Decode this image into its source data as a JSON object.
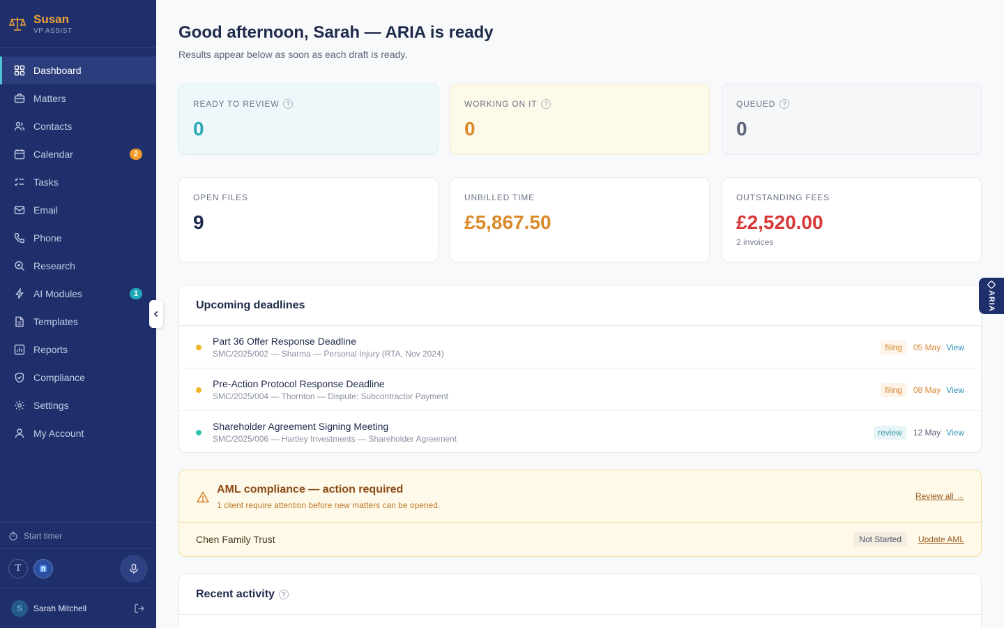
{
  "brand": {
    "name": "Susan",
    "subtitle": "VP ASSIST"
  },
  "sidebar": {
    "items": [
      {
        "label": "Dashboard",
        "icon": "grid-icon",
        "active": true
      },
      {
        "label": "Matters",
        "icon": "briefcase-icon"
      },
      {
        "label": "Contacts",
        "icon": "users-icon"
      },
      {
        "label": "Calendar",
        "icon": "calendar-icon",
        "badge": "2"
      },
      {
        "label": "Tasks",
        "icon": "checklist-icon"
      },
      {
        "label": "Email",
        "icon": "mail-icon"
      },
      {
        "label": "Phone",
        "icon": "phone-icon"
      },
      {
        "label": "Research",
        "icon": "search-icon"
      },
      {
        "label": "AI Modules",
        "icon": "bolt-icon",
        "badge": "1"
      },
      {
        "label": "Templates",
        "icon": "document-icon"
      },
      {
        "label": "Reports",
        "icon": "chart-icon"
      },
      {
        "label": "Compliance",
        "icon": "shield-icon"
      },
      {
        "label": "Settings",
        "icon": "gear-icon"
      },
      {
        "label": "My Account",
        "icon": "user-icon"
      }
    ],
    "timer_label": "Start timer",
    "tools": {
      "t_label": "T"
    },
    "user": {
      "initial": "S",
      "name": "Sarah Mitchell"
    }
  },
  "header": {
    "greeting": "Good afternoon, Sarah — ARIA is ready",
    "subtitle": "Results appear below as soon as each draft is ready."
  },
  "status_cards": {
    "ready": {
      "label": "READY TO REVIEW",
      "value": "0"
    },
    "working": {
      "label": "WORKING ON IT",
      "value": "0"
    },
    "queued": {
      "label": "QUEUED",
      "value": "0"
    }
  },
  "metric_cards": {
    "open_files": {
      "label": "OPEN FILES",
      "value": "9"
    },
    "unbilled": {
      "label": "UNBILLED TIME",
      "value": "£5,867.50"
    },
    "fees": {
      "label": "OUTSTANDING FEES",
      "value": "£2,520.00",
      "sub": "2 invoices"
    }
  },
  "deadlines": {
    "title": "Upcoming deadlines",
    "rows": [
      {
        "title": "Part 36 Offer Response Deadline",
        "meta": "SMC/2025/002 — Sharma — Personal Injury (RTA, Nov 2024)",
        "tag": "filing",
        "date": "05 May",
        "link": "View"
      },
      {
        "title": "Pre-Action Protocol Response Deadline",
        "meta": "SMC/2025/004 — Thornton — Dispute: Subcontractor Payment",
        "tag": "filing",
        "date": "08 May",
        "link": "View"
      },
      {
        "title": "Shareholder Agreement Signing Meeting",
        "meta": "SMC/2025/006 — Hartley Investments — Shareholder Agreement",
        "tag": "review",
        "date": "12 May",
        "link": "View"
      }
    ]
  },
  "aml": {
    "title": "AML compliance — action required",
    "subtitle": "1 client require attention before new matters can be opened.",
    "review_link": "Review all →",
    "client": "Chen Family Trust",
    "status": "Not Started",
    "update_link": "Update AML"
  },
  "recent": {
    "title": "Recent activity"
  },
  "aria_tab": {
    "label": "ARIA"
  },
  "colors": {
    "sidebar": "#1e2f6b",
    "accent_orange": "#d98a2b",
    "accent_teal": "#2ba7b5",
    "danger": "#d93838"
  }
}
